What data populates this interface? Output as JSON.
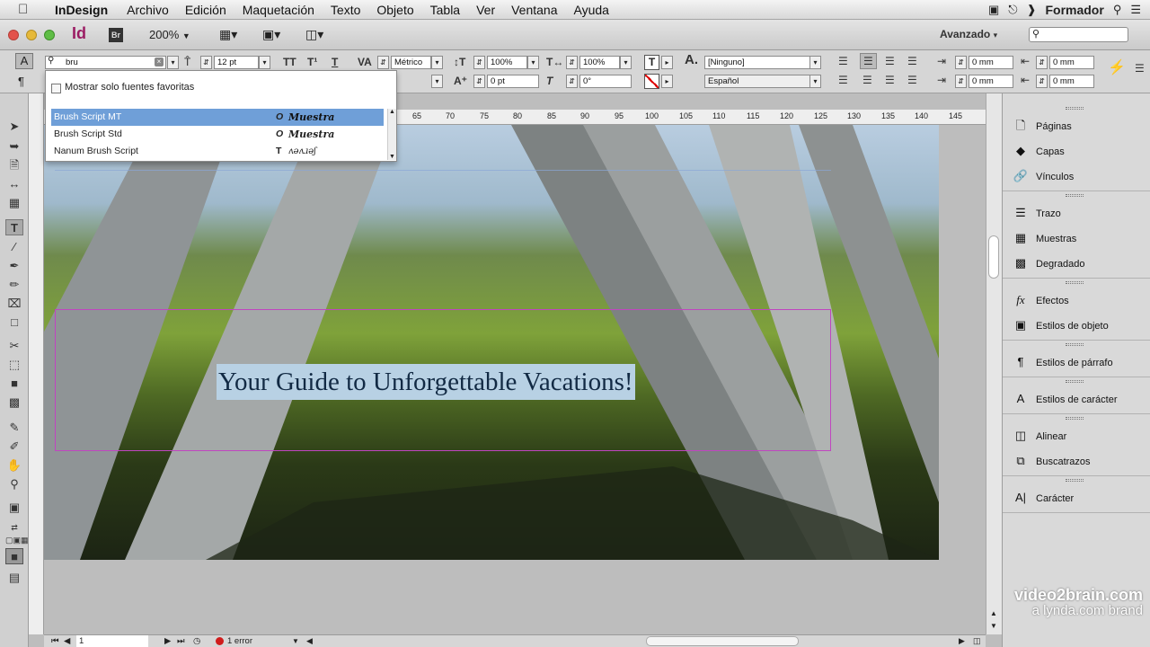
{
  "menubar": {
    "app": "InDesign",
    "items": [
      "Archivo",
      "Edición",
      "Maquetación",
      "Texto",
      "Objeto",
      "Tabla",
      "Ver",
      "Ventana",
      "Ayuda"
    ],
    "user": "Formador"
  },
  "appbar": {
    "logo": "Id",
    "bridge": "Br",
    "zoom": "200%",
    "workspace": "Avanzado",
    "search_placeholder": ""
  },
  "control": {
    "font_search": "bru",
    "font_size": "12 pt",
    "kerning": "Métrico",
    "vscale": "100%",
    "hscale": "100%",
    "baseline": "0 pt",
    "skew": "0°",
    "char_style": "[Ninguno]",
    "language": "Español",
    "indent_left": "0 mm",
    "indent_right": "0 mm",
    "space_before": "0 mm",
    "space_after": "0 mm"
  },
  "fontpopup": {
    "favorites_label": "Mostrar solo fuentes favoritas",
    "fonts": [
      {
        "name": "Brush Script MT",
        "sample": "Muestra",
        "type_icon": "opentype-icon"
      },
      {
        "name": "Brush Script Std",
        "sample": "Muestra",
        "type_icon": "opentype-icon"
      },
      {
        "name": "Nanum Brush Script",
        "sample": "ʌəʌɹəʃ",
        "type_icon": "truetype-icon"
      }
    ],
    "selected_index": 0
  },
  "ruler": {
    "ticks": [
      "65",
      "70",
      "75",
      "80",
      "85",
      "90",
      "95",
      "100",
      "105",
      "110",
      "115",
      "120",
      "125",
      "130",
      "135",
      "140",
      "145"
    ]
  },
  "document": {
    "headline": "Your Guide to Unforgettable Vacations!"
  },
  "panels": {
    "groups": [
      [
        "Páginas",
        "Capas",
        "Vínculos"
      ],
      [
        "Trazo",
        "Muestras",
        "Degradado"
      ],
      [
        "Efectos",
        "Estilos de objeto"
      ],
      [
        "Estilos de párrafo"
      ],
      [
        "Estilos de carácter"
      ],
      [
        "Alinear",
        "Buscatrazos"
      ],
      [
        "Carácter"
      ]
    ]
  },
  "status": {
    "page": "1",
    "errors": "1 error"
  },
  "watermark": {
    "line1": "video2brain.com",
    "line2": "a lynda.com brand"
  },
  "colors": {
    "selection": "#b8d1e4",
    "font_highlight": "#6f9fd8",
    "frame_guide": "#c045c0",
    "error": "#d01c1c"
  }
}
